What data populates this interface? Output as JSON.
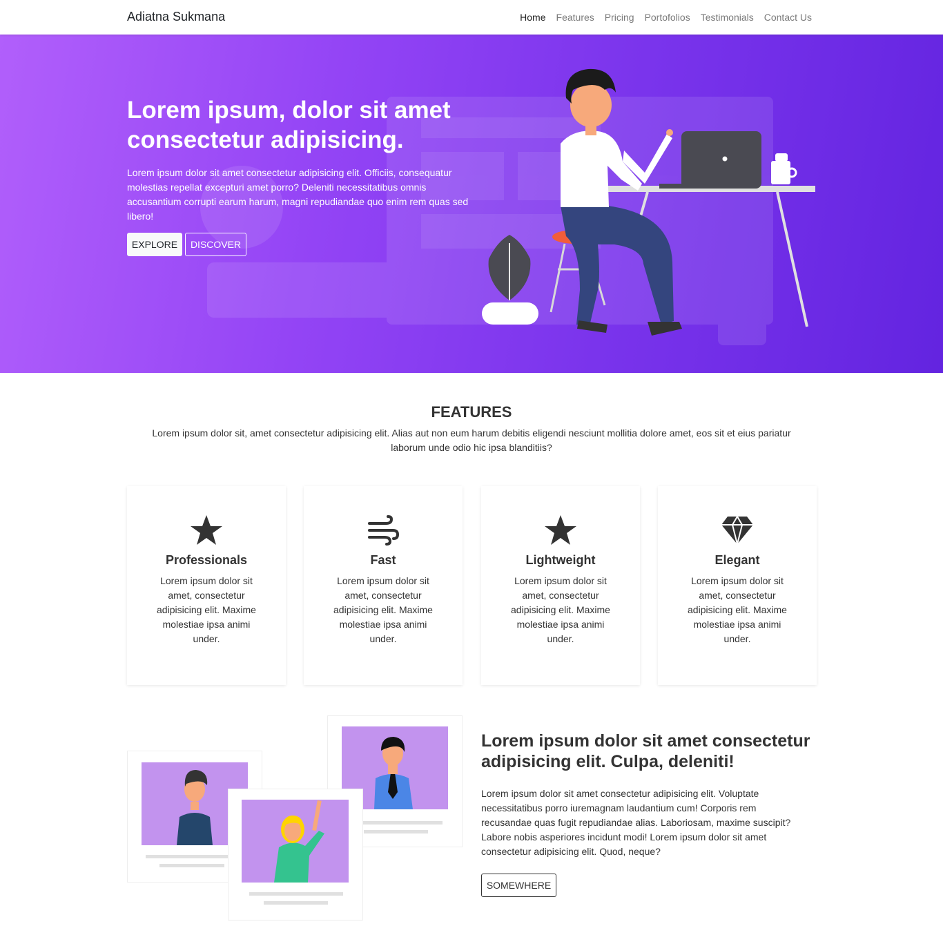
{
  "navbar": {
    "brand": "Adiatna Sukmana",
    "links": [
      "Home",
      "Features",
      "Pricing",
      "Portofolios",
      "Testimonials",
      "Contact Us"
    ]
  },
  "hero": {
    "title": "Lorem ipsum, dolor sit amet consectetur adipisicing.",
    "text": "Lorem ipsum dolor sit amet consectetur adipisicing elit. Officiis, consequatur molestias repellat excepturi amet porro? Deleniti necessitatibus omnis accusantium corrupti earum harum, magni repudiandae quo enim rem quas sed libero!",
    "buttons": {
      "explore": "EXPLORE",
      "discover": "DISCOVER"
    },
    "gradient": [
      "#b15ffb",
      "#6324e0"
    ]
  },
  "features": {
    "title": "FEATURES",
    "subtitle": "Lorem ipsum dolor sit, amet consectetur adipisicing elit. Alias aut non eum harum debitis eligendi nesciunt mollitia dolore amet, eos sit et eius pariatur laborum unde odio hic ipsa blanditiis?",
    "cards": [
      {
        "icon": "star-icon",
        "title": "Professionals",
        "text": "Lorem ipsum dolor sit amet, consectetur adipisicing elit. Maxime molestiae ipsa animi under."
      },
      {
        "icon": "wind-icon",
        "title": "Fast",
        "text": "Lorem ipsum dolor sit amet, consectetur adipisicing elit. Maxime molestiae ipsa animi under."
      },
      {
        "icon": "star-icon",
        "title": "Lightweight",
        "text": "Lorem ipsum dolor sit amet, consectetur adipisicing elit. Maxime molestiae ipsa animi under."
      },
      {
        "icon": "gem-icon",
        "title": "Elegant",
        "text": "Lorem ipsum dolor sit amet, consectetur adipisicing elit. Maxime molestiae ipsa animi under."
      }
    ]
  },
  "about": {
    "title": "Lorem ipsum dolor sit amet consectetur adipisicing elit. Culpa, deleniti!",
    "text": "Lorem ipsum dolor sit amet consectetur adipisicing elit. Voluptate necessitatibus porro iuremagnam laudantium cum! Corporis rem recusandae quas fugit repudiandae alias. Laboriosam, maxime suscipit? Labore nobis asperiores incidunt modi! Lorem ipsum dolor sit amet consectetur adipisicing elit. Quod, neque?",
    "button": "SOMEWHERE"
  }
}
